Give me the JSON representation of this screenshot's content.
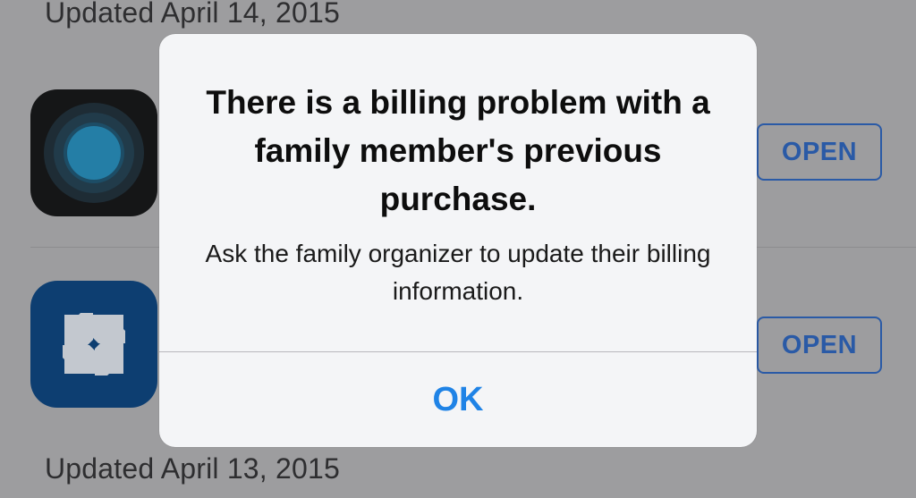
{
  "list": {
    "section_top": "Updated April 14, 2015",
    "section_bottom": "Updated April 13, 2015",
    "rows": [
      {
        "icon": "circle-target-icon",
        "button_label": "OPEN"
      },
      {
        "icon": "octagon-bank-logo-icon",
        "button_label": "OPEN"
      }
    ]
  },
  "alert": {
    "title": "There is a billing problem with a family member's previous purchase.",
    "message": "Ask the family organizer to update their billing information.",
    "ok_label": "OK"
  },
  "colors": {
    "dimmed_background": "#9d9d9f",
    "alert_background": "#f4f5f7",
    "ok_blue": "#1f83e6",
    "open_button_blue": "#2a5aa6"
  }
}
